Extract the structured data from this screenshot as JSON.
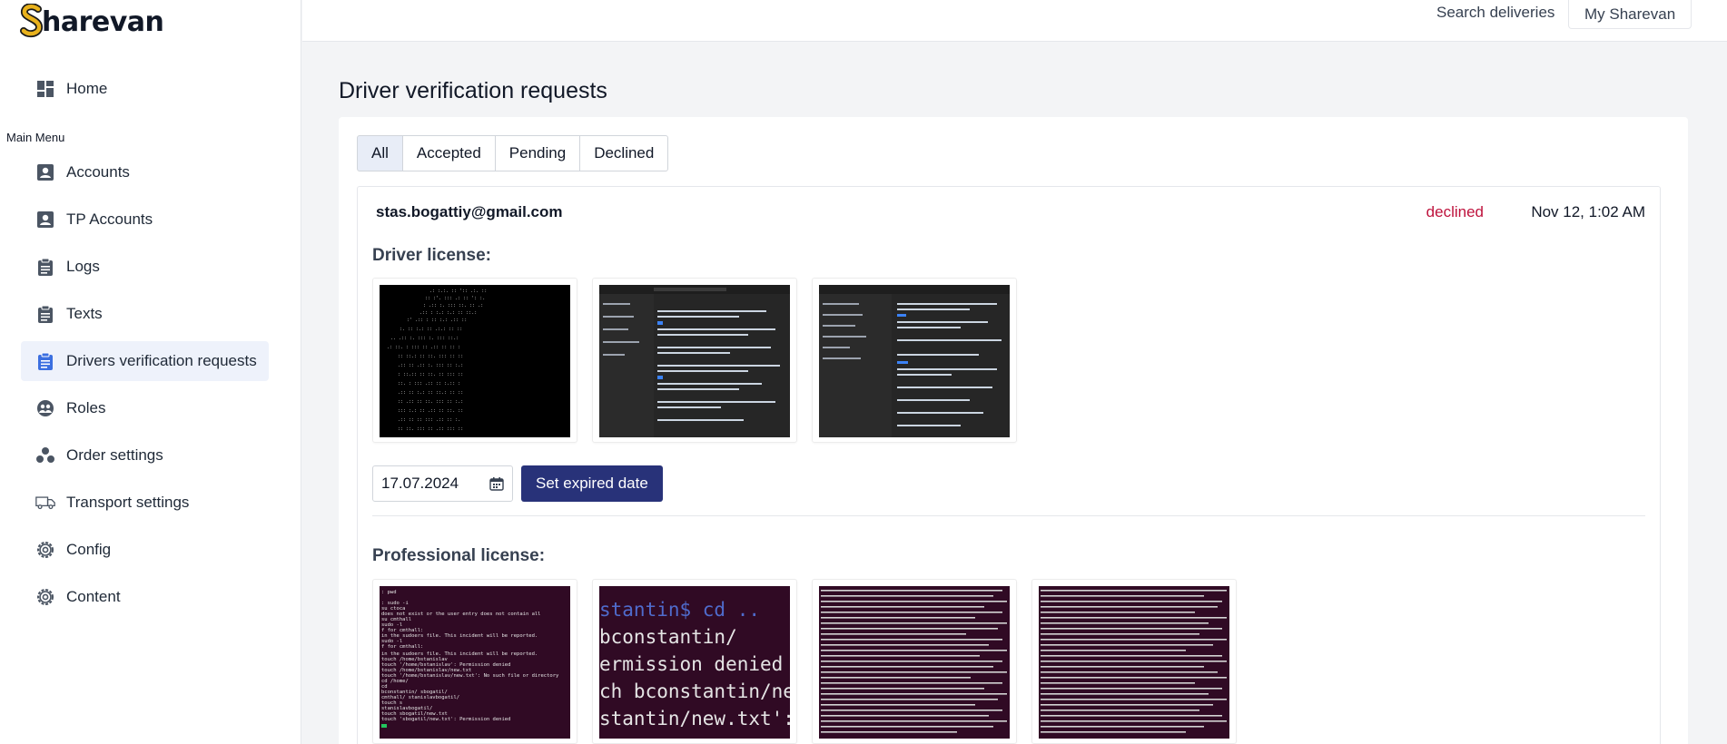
{
  "app": {
    "name": "harevan",
    "brand_color": "#e9b21d"
  },
  "sidebar": {
    "section_title": "Main Menu",
    "items": [
      {
        "label": "Home",
        "icon": "dashboard-icon",
        "active": false
      },
      {
        "label": "Accounts",
        "icon": "account-box-icon",
        "active": false
      },
      {
        "label": "TP Accounts",
        "icon": "account-box-icon",
        "active": false
      },
      {
        "label": "Logs",
        "icon": "clipboard-icon",
        "active": false
      },
      {
        "label": "Texts",
        "icon": "clipboard-icon",
        "active": false
      },
      {
        "label": "Drivers verification requests",
        "icon": "clipboard-icon",
        "active": true
      },
      {
        "label": "Roles",
        "icon": "roles-icon",
        "active": false
      },
      {
        "label": "Order settings",
        "icon": "bubbles-icon",
        "active": false
      },
      {
        "label": "Transport settings",
        "icon": "truck-icon",
        "active": false
      },
      {
        "label": "Config",
        "icon": "gear-icon",
        "active": false
      },
      {
        "label": "Content",
        "icon": "gear-icon",
        "active": false
      }
    ]
  },
  "topbar": {
    "search_link": "Search deliveries",
    "account_button": "My Sharevan"
  },
  "main": {
    "title": "Driver verification requests",
    "tabs": [
      {
        "label": "All",
        "active": true
      },
      {
        "label": "Accepted",
        "active": false
      },
      {
        "label": "Pending",
        "active": false
      },
      {
        "label": "Declined",
        "active": false
      }
    ],
    "request": {
      "email": "stas.bogattiy@gmail.com",
      "status": "declined",
      "status_color": "#be123c",
      "date": "Nov 12, 1:02 AM",
      "driver_license_label": "Driver license:",
      "expire_date_value": "17.07.2024",
      "set_expired_button": "Set expired date",
      "professional_license_label": "Professional license:",
      "pro_thumb_text": [
        "stantin$ cd ..",
        "bconstantin/",
        "ermission denied",
        "ch bconstantin/ne",
        "stantin/new.txt':"
      ]
    }
  }
}
